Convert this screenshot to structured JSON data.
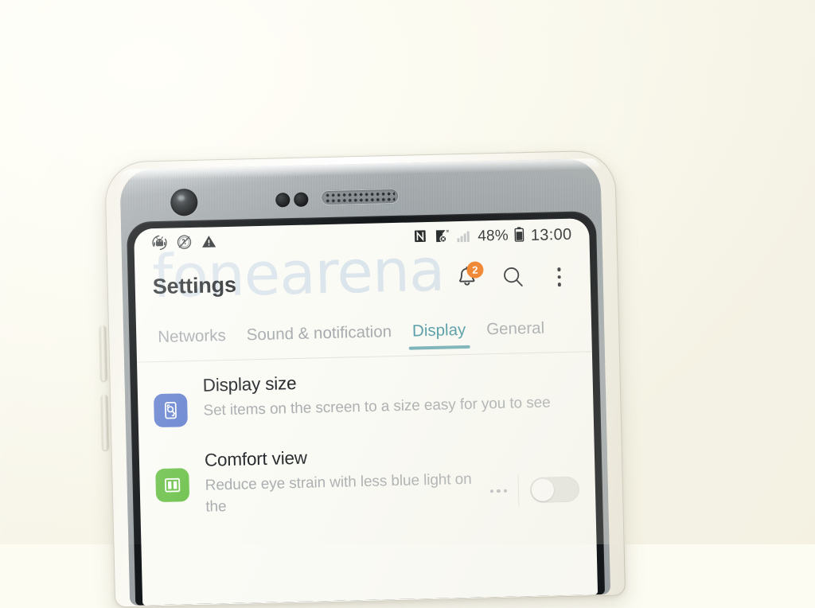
{
  "scene": {
    "background_color": "#fdfcf2",
    "device_frame_color": "#9aa1a4",
    "device_shell_color": "#f7f5ec",
    "bezel_color": "#141719",
    "screen_color": "#fbfbf6"
  },
  "watermark": {
    "text": "fonearena",
    "color": "#d3dfe9"
  },
  "hardware": {
    "front_camera": "front-camera",
    "sensor_left": "proximity-sensor",
    "sensor_right": "light-sensor",
    "earpiece": "earpiece-speaker",
    "volume_up": "volume-up-button",
    "volume_down": "volume-down-button"
  },
  "status_bar": {
    "left_icons": [
      {
        "name": "android-debug-icon",
        "glyph": "debug"
      },
      {
        "name": "silent-mode-icon",
        "glyph": "mute"
      },
      {
        "name": "warning-icon",
        "glyph": "warning"
      }
    ],
    "right": {
      "nfc_icon": "nfc-icon",
      "data_disabled_icon": "mobile-data-off-icon",
      "signal_icon": "signal-bars-icon",
      "battery_percent": "48%",
      "battery_icon": "battery-icon",
      "clock": "13:00"
    }
  },
  "app_bar": {
    "title": "Settings",
    "actions": [
      {
        "name": "notifications-bell-button",
        "badge": "2",
        "badge_color": "#f07f25"
      },
      {
        "name": "search-button"
      },
      {
        "name": "overflow-menu-button"
      }
    ]
  },
  "tabs": {
    "active_color": "#4e9aa6",
    "inactive_color": "#a5aaad",
    "underline_color": "#74b0b8",
    "items": [
      {
        "label": "Networks",
        "active": false
      },
      {
        "label": "Sound & notification",
        "active": false
      },
      {
        "label": "Display",
        "active": true
      },
      {
        "label": "General",
        "active": false
      }
    ]
  },
  "settings_list": [
    {
      "title": "Display size",
      "subtitle": "Set items on the screen to a size easy for you to see",
      "icon_name": "display-size-icon",
      "icon_color": "#6380cf",
      "has_toggle": false,
      "has_overflow": false
    },
    {
      "title": "Comfort view",
      "subtitle": "Reduce eye strain with less blue light on the",
      "icon_name": "comfort-view-icon",
      "icon_color": "#6ec24c",
      "has_toggle": true,
      "toggle_state": "off",
      "has_overflow": true
    }
  ]
}
